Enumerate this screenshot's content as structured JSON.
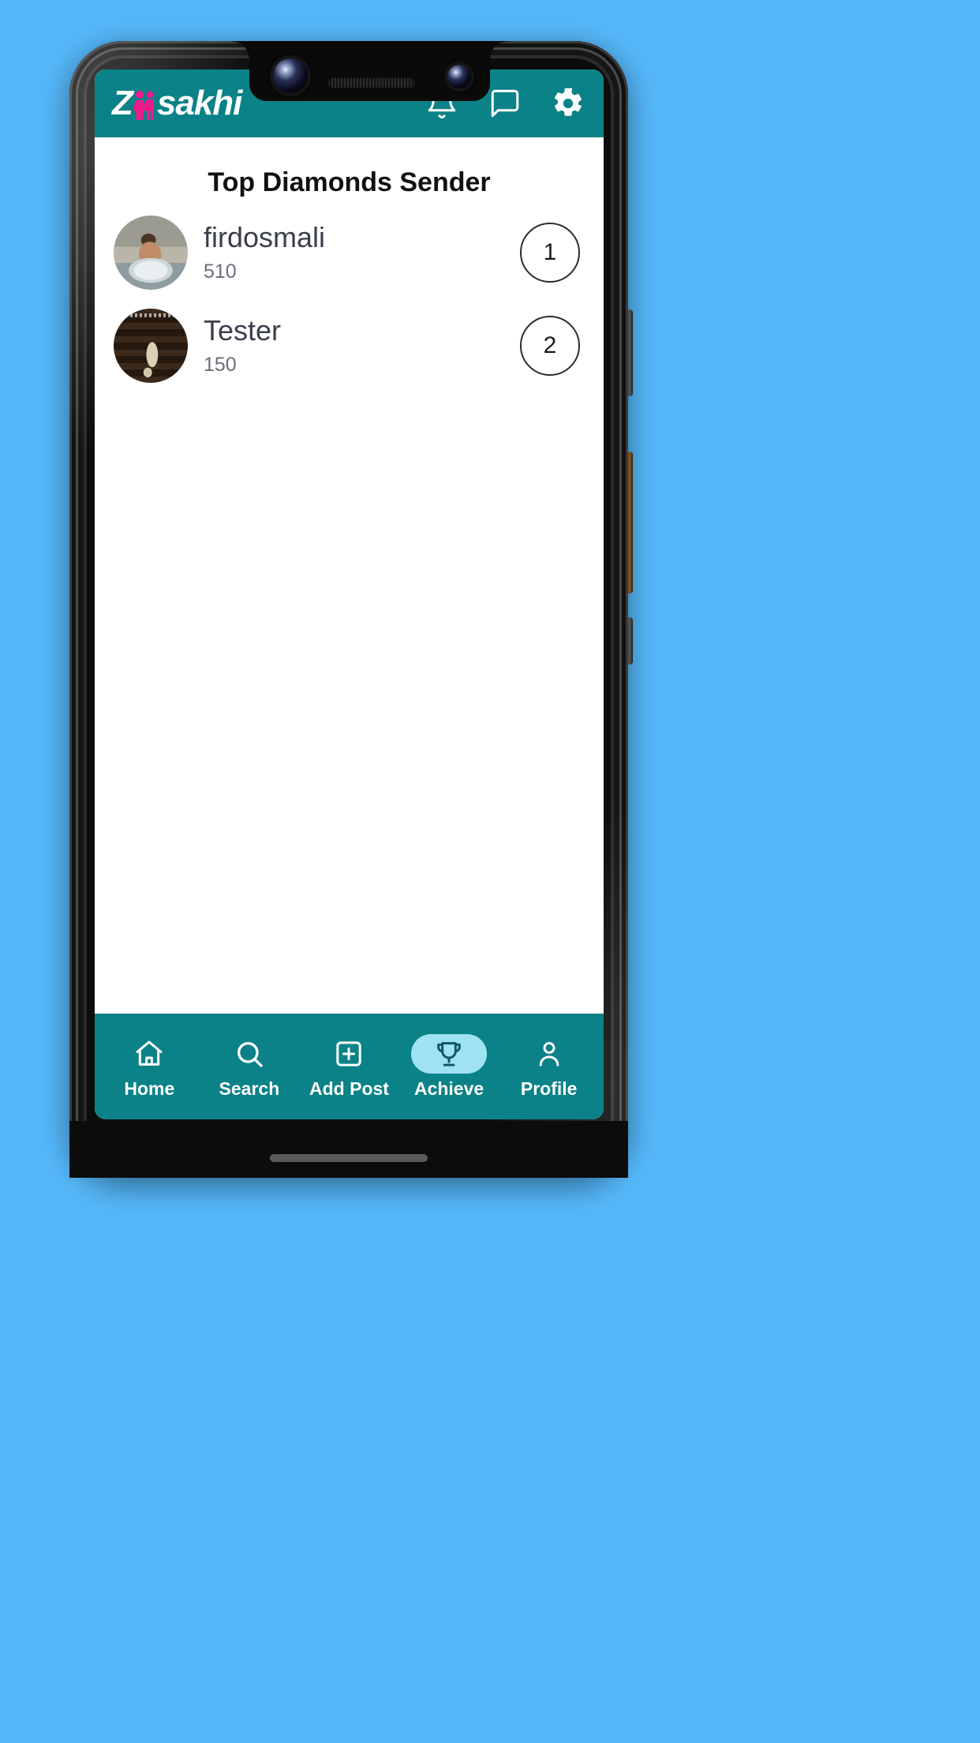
{
  "app": {
    "brand_prefix": "Z",
    "brand_suffix": "sakhi",
    "brand_icon": "couple-icon"
  },
  "header": {
    "icons": [
      {
        "name": "bell-icon",
        "label": "Notifications"
      },
      {
        "name": "chat-icon",
        "label": "Messages"
      },
      {
        "name": "gear-icon",
        "label": "Settings"
      }
    ]
  },
  "main": {
    "title": "Top Diamonds Sender",
    "rows": [
      {
        "name": "firdosmali",
        "score": "510",
        "rank": "1",
        "avatar": "baby-in-tub-photo"
      },
      {
        "name": "Tester",
        "score": "150",
        "rank": "2",
        "avatar": "cinema-seats-photo"
      }
    ]
  },
  "bottom_nav": {
    "items": [
      {
        "label": "Home",
        "icon": "home-icon",
        "active": false
      },
      {
        "label": "Search",
        "icon": "search-icon",
        "active": false
      },
      {
        "label": "Add Post",
        "icon": "plus-box-icon",
        "active": false
      },
      {
        "label": "Achieve",
        "icon": "trophy-icon",
        "active": true
      },
      {
        "label": "Profile",
        "icon": "person-icon",
        "active": false
      }
    ]
  },
  "colors": {
    "brand_teal": "#0b8287",
    "page_background": "#55b8fa",
    "accent_pink": "#ef1a8c",
    "active_pill": "#9fe3f2",
    "screen_background": "#ffffff"
  }
}
